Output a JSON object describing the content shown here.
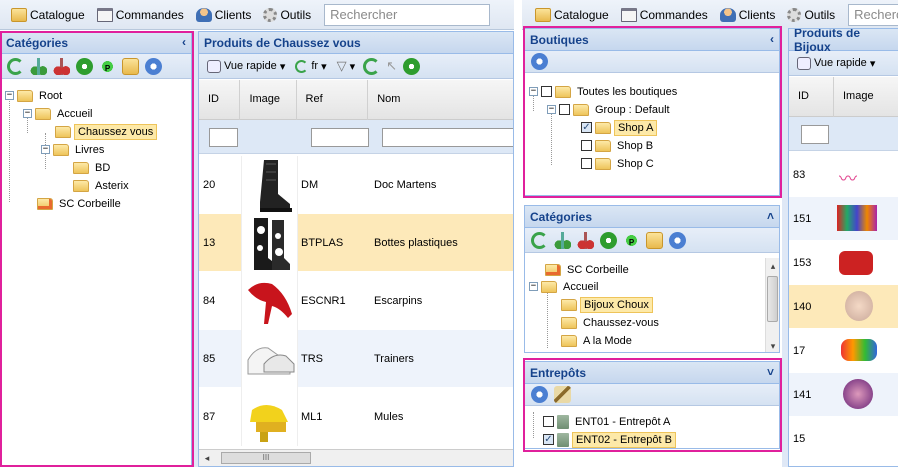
{
  "toolbar": {
    "catalogue": "Catalogue",
    "commandes": "Commandes",
    "clients": "Clients",
    "outils": "Outils",
    "search_placeholder": "Rechercher",
    "search_placeholder_right": "Recherc"
  },
  "left": {
    "categories_title": "Catégories",
    "tree": {
      "root": "Root",
      "accueil": "Accueil",
      "chaussez": "Chaussez vous",
      "livres": "Livres",
      "bd": "BD",
      "asterix": "Asterix",
      "corbeille": "SC Corbeille"
    },
    "products_title": "Produits de Chaussez vous",
    "vue_rapide": "Vue rapide",
    "lang": "fr",
    "columns": [
      "ID",
      "Image",
      "Ref",
      "Nom"
    ],
    "rows": [
      {
        "id": "20",
        "ref": "DM",
        "nom": "Doc Martens"
      },
      {
        "id": "13",
        "ref": "BTPLAS",
        "nom": "Bottes plastiques"
      },
      {
        "id": "84",
        "ref": "ESCNR1",
        "nom": "Escarpins"
      },
      {
        "id": "85",
        "ref": "TRS",
        "nom": "Trainers"
      },
      {
        "id": "87",
        "ref": "ML1",
        "nom": "Mules"
      }
    ],
    "scroll_mark": "III"
  },
  "right": {
    "boutiques_title": "Boutiques",
    "boutiques_tree": {
      "all": "Toutes les boutiques",
      "group": "Group : Default",
      "shop_a": "Shop A",
      "shop_b": "Shop B",
      "shop_c": "Shop C"
    },
    "categories_title": "Catégories",
    "cat_tree": {
      "corbeille": "SC Corbeille",
      "accueil": "Accueil",
      "bijoux": "Bijoux Choux",
      "chaussez": "Chaussez-vous",
      "mode": "A la Mode"
    },
    "entrepots_title": "Entrepôts",
    "entrepots": [
      {
        "label": "ENT01 - Entrepôt A",
        "checked": false
      },
      {
        "label": "ENT02 - Entrepôt B",
        "checked": true
      }
    ],
    "products_title": "Produits de Bijoux",
    "vue_rapide": "Vue rapide",
    "columns": [
      "ID",
      "Image"
    ],
    "rows": [
      "83",
      "151",
      "153",
      "140",
      "17",
      "141",
      "15"
    ]
  }
}
